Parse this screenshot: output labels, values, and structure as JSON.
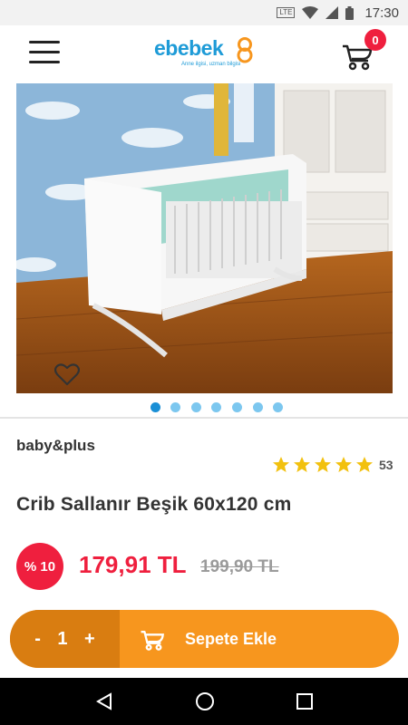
{
  "status_bar": {
    "network": "LTE",
    "time": "17:30"
  },
  "header": {
    "logo_text": "ebebek",
    "logo_tagline": "Anne ilgisi, uzman bilgisi",
    "cart_count": "0"
  },
  "gallery": {
    "slide_count": 7,
    "active_index": 0
  },
  "product": {
    "brand": "baby&plus",
    "rating": 5,
    "review_count": "53",
    "title": "Crib Sallanır Beşik 60x120 cm",
    "discount_badge": "% 10",
    "price": "179,91 TL",
    "old_price": "199,90 TL"
  },
  "cart_bar": {
    "minus_label": "-",
    "quantity": "1",
    "plus_label": "+",
    "add_label": "Sepete Ekle"
  },
  "colors": {
    "brand_blue": "#1e9bd7",
    "accent_orange": "#f7961e",
    "accent_orange_dark": "#d97d11",
    "sale_red": "#ef1f3e",
    "star_yellow": "#f2c10f"
  }
}
